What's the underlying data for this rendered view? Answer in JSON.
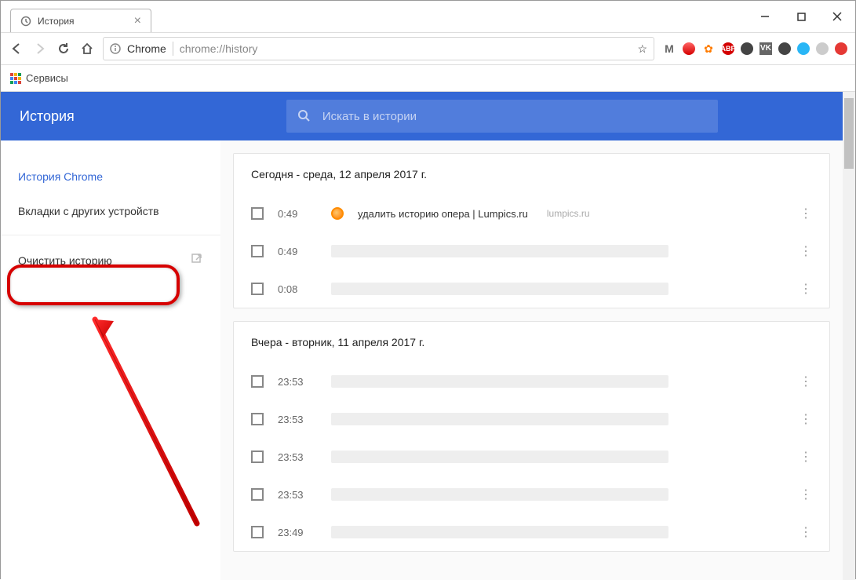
{
  "window": {
    "tab_title": "История"
  },
  "address_bar": {
    "zone": "Chrome",
    "url": "chrome://history"
  },
  "bookmark_bar": {
    "services": "Сервисы"
  },
  "header": {
    "title": "История",
    "search_placeholder": "Искать в истории"
  },
  "sidebar": {
    "chrome_history": "История Chrome",
    "other_devices": "Вкладки с других устройств",
    "clear_history": "Очистить историю"
  },
  "days": [
    {
      "label": "Сегодня - среда, 12 апреля 2017 г.",
      "entries": [
        {
          "time": "0:49",
          "title": "удалить историю опера | Lumpics.ru",
          "domain": "lumpics.ru",
          "has_favicon": true,
          "blur": false
        },
        {
          "time": "0:49",
          "blur": true
        },
        {
          "time": "0:08",
          "blur": true
        }
      ]
    },
    {
      "label": "Вчера - вторник, 11 апреля 2017 г.",
      "entries": [
        {
          "time": "23:53",
          "blur": true
        },
        {
          "time": "23:53",
          "blur": true
        },
        {
          "time": "23:53",
          "blur": true
        },
        {
          "time": "23:53",
          "blur": true
        },
        {
          "time": "23:49",
          "blur": true
        }
      ]
    }
  ]
}
